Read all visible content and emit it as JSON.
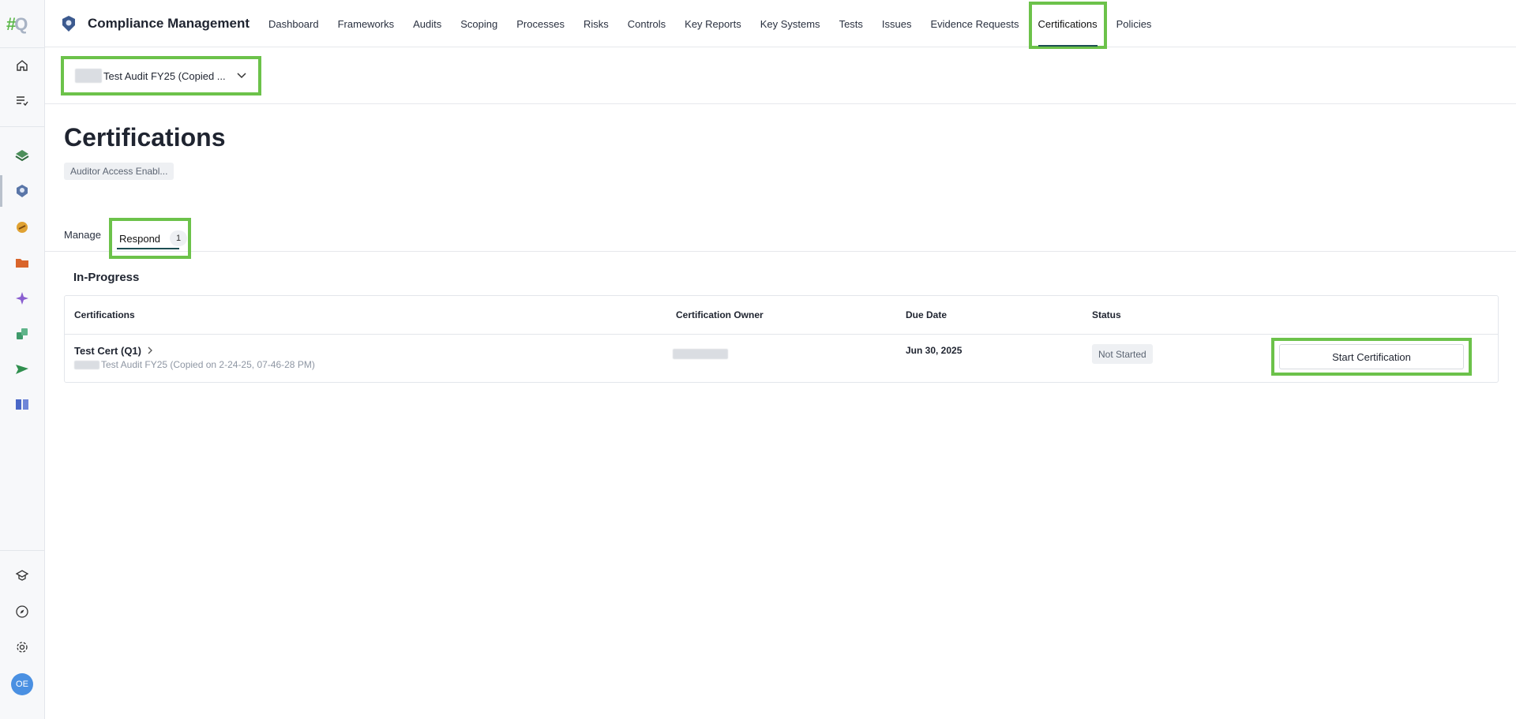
{
  "app": {
    "title": "Compliance Management"
  },
  "logo": {
    "hash": "#",
    "q": "Q"
  },
  "nav": {
    "items": [
      {
        "label": "Dashboard"
      },
      {
        "label": "Frameworks"
      },
      {
        "label": "Audits"
      },
      {
        "label": "Scoping"
      },
      {
        "label": "Processes"
      },
      {
        "label": "Risks"
      },
      {
        "label": "Controls"
      },
      {
        "label": "Key Reports"
      },
      {
        "label": "Key Systems"
      },
      {
        "label": "Tests"
      },
      {
        "label": "Issues"
      },
      {
        "label": "Evidence Requests"
      },
      {
        "label": "Certifications",
        "active": true
      },
      {
        "label": "Policies"
      }
    ]
  },
  "audit_selector": {
    "value": "Test Audit FY25 (Copied ..."
  },
  "page": {
    "title": "Certifications",
    "access_badge": "Auditor Access Enabl..."
  },
  "tabs": {
    "manage": "Manage",
    "respond": "Respond",
    "respond_count": "1"
  },
  "section": {
    "title": "In-Progress"
  },
  "table": {
    "headers": {
      "certifications": "Certifications",
      "owner": "Certification Owner",
      "due_date": "Due Date",
      "status": "Status"
    },
    "rows": [
      {
        "name": "Test Cert (Q1)",
        "audit": "Test Audit FY25 (Copied on 2-24-25, 07-46-28 PM)",
        "due_date": "Jun 30, 2025",
        "status": "Not Started",
        "action": "Start Certification"
      }
    ]
  },
  "user": {
    "initials": "OE"
  },
  "colors": {
    "highlight": "#6cc24a",
    "accent": "#1d4e52",
    "avatar": "#4a90e2"
  }
}
